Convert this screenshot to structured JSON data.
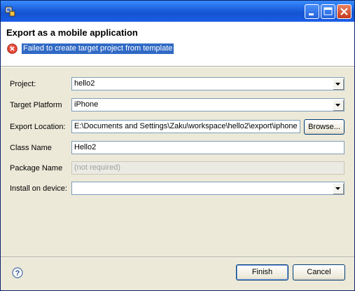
{
  "window": {
    "title": ""
  },
  "header": {
    "title": "Export as a mobile application",
    "error_message": "Failed to create target project from template"
  },
  "form": {
    "project": {
      "label": "Project:",
      "value": "hello2"
    },
    "target_platform": {
      "label": "Target Platform",
      "value": "iPhone"
    },
    "export_location": {
      "label": "Export Location:",
      "value": "E:\\Documents and Settings\\Zaku\\workspace\\hello2\\export\\iphone",
      "browse_label": "Browse..."
    },
    "class_name": {
      "label": "Class Name",
      "value": "Hello2"
    },
    "package_name": {
      "label": "Package Name",
      "value": "(not required)"
    },
    "install_on_device": {
      "label": "Install on device:",
      "value": ""
    }
  },
  "footer": {
    "finish_label": "Finish",
    "cancel_label": "Cancel"
  },
  "icons": {
    "app": "app-icon",
    "error": "error-icon",
    "help": "help-icon",
    "minimize": "minimize-icon",
    "maximize": "maximize-icon",
    "close": "close-icon",
    "dropdown": "chevron-down-icon"
  }
}
